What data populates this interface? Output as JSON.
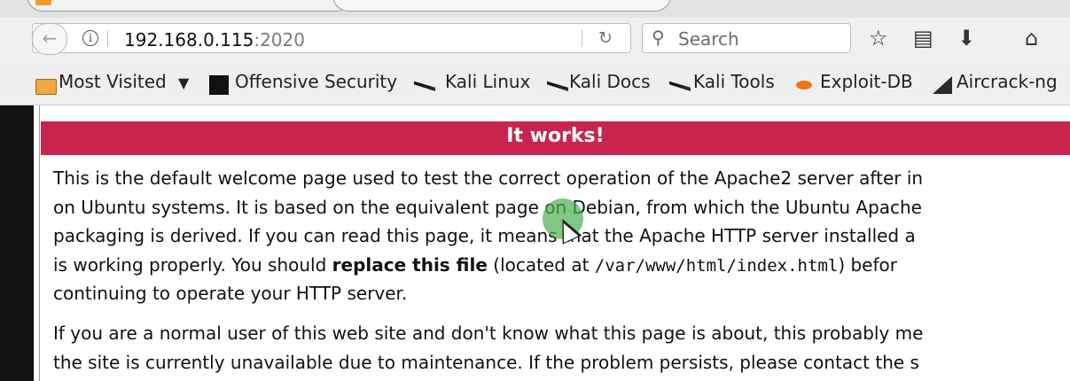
{
  "browser": {
    "address": {
      "host": "192.168.0.115",
      "port": ":2020"
    },
    "search": {
      "placeholder": "Search"
    },
    "icons": [
      "back-icon",
      "info-icon",
      "reload-icon",
      "search-icon",
      "star-icon",
      "reader-icon",
      "download-icon",
      "home-icon"
    ]
  },
  "bookmarks": {
    "items": [
      {
        "label": "Most Visited",
        "icon": "folder-icon"
      },
      {
        "label": "Offensive Security",
        "icon": "offsec-icon"
      },
      {
        "label": "Kali Linux",
        "icon": "kali-dragon-icon"
      },
      {
        "label": "Kali Docs",
        "icon": "kali-dragon-icon"
      },
      {
        "label": "Kali Tools",
        "icon": "kali-dragon-icon"
      },
      {
        "label": "Exploit-DB",
        "icon": "exploitdb-icon"
      },
      {
        "label": "Aircrack-ng",
        "icon": "aircrack-icon"
      }
    ]
  },
  "page": {
    "banner": "It works!",
    "para1": {
      "l1": "This is the default welcome page used to test the correct operation of the Apache2 server after in",
      "l2": "on Ubuntu systems. It is based on the equivalent page on Debian, from which the Ubuntu Apache",
      "l3a": "packaging is derived. If you can read this page, it means that the Apache HTTP server installed a",
      "l4a": "is working properly. You should ",
      "l4b": "replace this file",
      "l4c": " (located at ",
      "l4d": "/var/www/html/index.html",
      "l4e": ") befor",
      "l5": "continuing to operate your HTTP server."
    },
    "para2": {
      "l1": "If you are a normal user of this web site and don't know what this page is about, this probably me",
      "l2": "the site is currently unavailable due to maintenance. If the problem persists, please contact the s"
    }
  },
  "colors": {
    "banner": "#c7254e",
    "cursor_highlight": "#4caf50"
  }
}
